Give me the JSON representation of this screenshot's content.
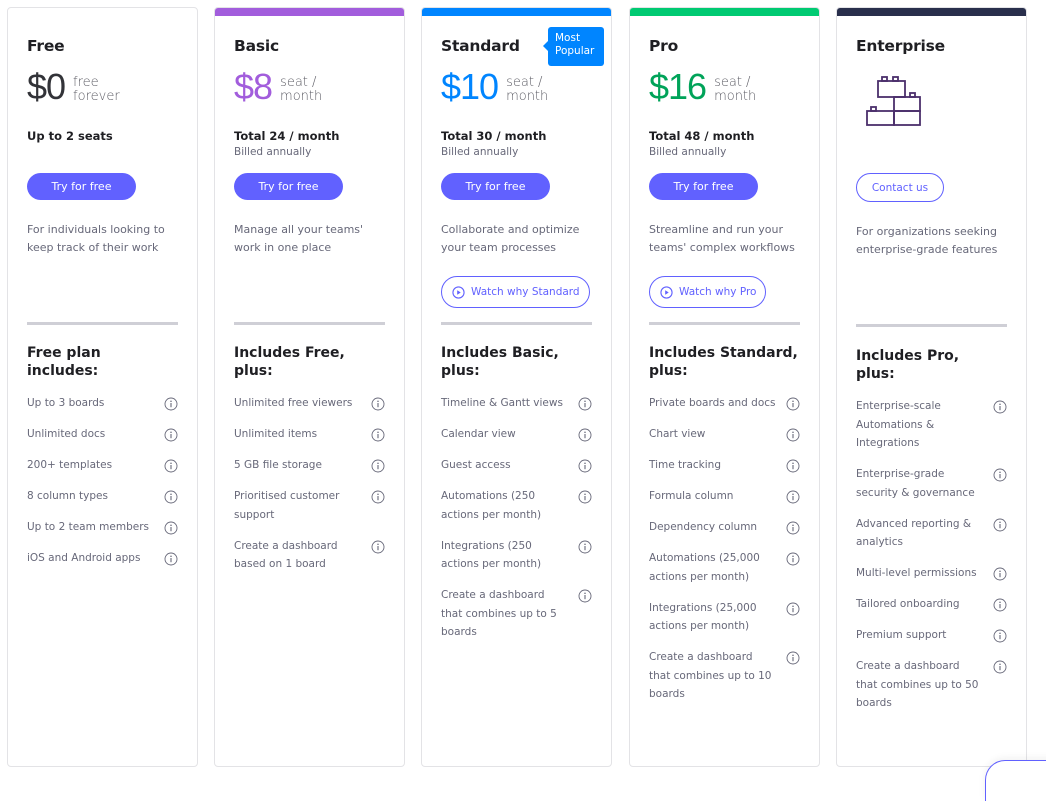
{
  "colors": {
    "accent": "#6161ff",
    "free_price": "#323338",
    "basic": "#a25ddc",
    "standard": "#0085ff",
    "pro": "#00ca72",
    "pro_price": "#00a359",
    "enterprise": "#292f4c",
    "badge": "#0085ff"
  },
  "plans": [
    {
      "name": "Free",
      "price": "$0",
      "unit_line1": "free",
      "unit_line2": "forever",
      "total": "Up to 2 seats",
      "billed": "",
      "cta": "Try for free",
      "description": "For individuals looking to keep track of their work",
      "features_title": "Free plan includes:",
      "features": [
        "Up to 3 boards",
        "Unlimited docs",
        "200+ templates",
        "8 column types",
        "Up to 2 team members",
        "iOS and Android apps"
      ]
    },
    {
      "name": "Basic",
      "price": "$8",
      "unit_line1": "seat /",
      "unit_line2": "month",
      "total": "Total 24 / month",
      "billed": "Billed annually",
      "cta": "Try for free",
      "description": "Manage all your teams' work in one place",
      "features_title": "Includes Free, plus:",
      "features": [
        "Unlimited free viewers",
        "Unlimited items",
        "5 GB file storage",
        "Prioritised customer support",
        "Create a dashboard based on 1 board"
      ]
    },
    {
      "name": "Standard",
      "badge": "Most Popular",
      "price": "$10",
      "unit_line1": "seat /",
      "unit_line2": "month",
      "total": "Total 30 / month",
      "billed": "Billed annually",
      "cta": "Try for free",
      "description": "Collaborate and optimize your team processes",
      "watch": "Watch why Standard",
      "features_title": "Includes Basic, plus:",
      "features": [
        "Timeline & Gantt views",
        "Calendar view",
        "Guest access",
        "Automations (250 actions per month)",
        "Integrations (250 actions per month)",
        "Create a dashboard that combines up to 5 boards"
      ]
    },
    {
      "name": "Pro",
      "price": "$16",
      "unit_line1": "seat /",
      "unit_line2": "month",
      "total": "Total 48 / month",
      "billed": "Billed annually",
      "cta": "Try for free",
      "description": "Streamline and run your teams' complex workflows",
      "watch": "Watch why Pro",
      "features_title": "Includes Standard, plus:",
      "features": [
        "Private boards and docs",
        "Chart view",
        "Time tracking",
        "Formula column",
        "Dependency column",
        "Automations (25,000 actions per month)",
        "Integrations (25,000 actions per month)",
        "Create a dashboard that combines up to 10 boards"
      ]
    },
    {
      "name": "Enterprise",
      "icon": "building-blocks-icon",
      "cta": "Contact us",
      "description": "For organizations seeking enterprise-grade features",
      "features_title": "Includes Pro, plus:",
      "features": [
        "Enterprise-scale Automations & Integrations",
        "Enterprise-grade security & governance",
        "Advanced reporting & analytics",
        "Multi-level permissions",
        "Tailored onboarding",
        "Premium support",
        "Create a dashboard that combines up to 50 boards"
      ]
    }
  ]
}
